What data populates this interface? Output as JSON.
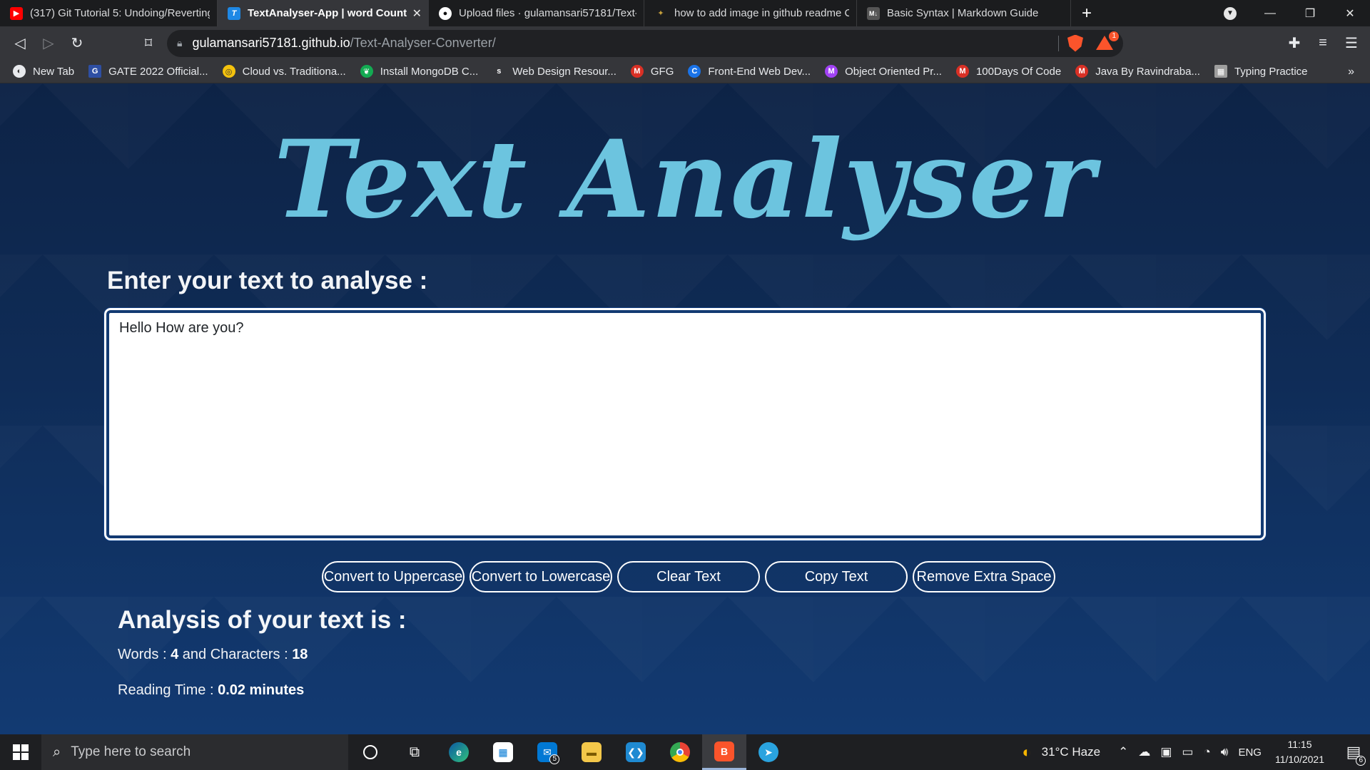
{
  "browser": {
    "tabs": [
      {
        "title": "(317) Git Tutorial 5: Undoing/Reverting",
        "icon": "youtube-icon",
        "color": "#ff0000",
        "glyph": "▶"
      },
      {
        "title": "TextAnalyser-App | word Counter",
        "icon": "t-app-icon",
        "color": "#1e88e5",
        "glyph": "T",
        "active": true
      },
      {
        "title": "Upload files · gulamansari57181/Text-",
        "icon": "github-icon",
        "color": "#ffffff",
        "glyph": "●"
      },
      {
        "title": "how to add image in github readme C",
        "icon": "grepper-icon",
        "color": "#35363a",
        "glyph": "✦"
      },
      {
        "title": "Basic Syntax | Markdown Guide",
        "icon": "markdown-icon",
        "color": "#555555",
        "glyph": "M↓"
      }
    ],
    "new_tab": "+",
    "address": {
      "host": "gulamansari57181.github.io",
      "path": "/Text-Analyser-Converter/"
    },
    "rewards_badge": "1",
    "bookmarks": [
      {
        "label": "New Tab",
        "icon": "chrome-icon",
        "color": "#e8eaed",
        "glyph": "◐"
      },
      {
        "label": "GATE 2022 Official...",
        "icon": "gate-icon",
        "color": "#2e4fa3",
        "glyph": "G"
      },
      {
        "label": "Cloud vs. Traditiona...",
        "icon": "cloud-site-icon",
        "color": "#f4c20d",
        "glyph": "◎"
      },
      {
        "label": "Install MongoDB C...",
        "icon": "mongodb-icon",
        "color": "#13aa52",
        "glyph": "❦"
      },
      {
        "label": "Web Design Resour...",
        "icon": "s-site-icon",
        "color": "#35363a",
        "glyph": "s"
      },
      {
        "label": "GFG",
        "icon": "gmail-icon",
        "color": "#d93025",
        "glyph": "M"
      },
      {
        "label": "Front-End Web Dev...",
        "icon": "c-site-icon",
        "color": "#1a73e8",
        "glyph": "C"
      },
      {
        "label": "Object Oriented Pr...",
        "icon": "m-purple-icon",
        "color": "#a142f4",
        "glyph": "M"
      },
      {
        "label": "100Days Of Code",
        "icon": "gmail-icon",
        "color": "#d93025",
        "glyph": "M"
      },
      {
        "label": "Java By Ravindraba...",
        "icon": "gmail-icon",
        "color": "#d93025",
        "glyph": "M"
      },
      {
        "label": "Typing Practice",
        "icon": "typing-icon",
        "color": "#9e9e9e",
        "glyph": "▦"
      }
    ],
    "bookmarks_more": "»"
  },
  "app": {
    "title": "Text Analyser",
    "prompt": "Enter your text to analyse :",
    "textarea_value": "Hello How are you?",
    "buttons": {
      "uppercase": "Convert to Uppercase",
      "lowercase": "Convert to Lowercase",
      "clear": "Clear Text",
      "copy": "Copy Text",
      "remove_space": "Remove Extra Space"
    },
    "analysis_title": "Analysis of your text is :",
    "words_label": "Words : ",
    "words_value": "4",
    "chars_label": " and Characters : ",
    "chars_value": "18",
    "reading_label": "Reading Time : ",
    "reading_value": "0.02 minutes"
  },
  "taskbar": {
    "search_placeholder": "Type here to search",
    "mail_badge": "5",
    "weather": "31°C  Haze",
    "language": "ENG",
    "time": "11:15",
    "date": "11/10/2021",
    "notification_count": "6"
  }
}
